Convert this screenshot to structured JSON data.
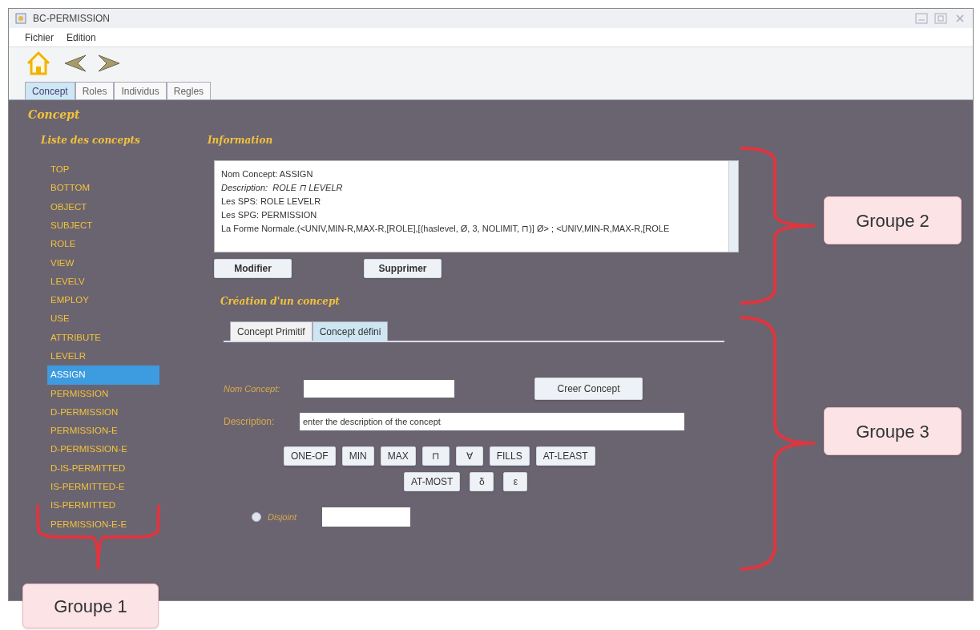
{
  "window": {
    "title": "BC-PERMISSION"
  },
  "menu": [
    "Fichier",
    "Edition"
  ],
  "tabs": [
    {
      "label": "Concept",
      "selected": true
    },
    {
      "label": "Roles",
      "selected": false
    },
    {
      "label": "Individus",
      "selected": false
    },
    {
      "label": "Regles",
      "selected": false
    }
  ],
  "panel_title": "Concept",
  "concept_list": {
    "title": "Liste des concepts",
    "items": [
      {
        "label": "TOP",
        "selected": false
      },
      {
        "label": "BOTTOM",
        "selected": false
      },
      {
        "label": "OBJECT",
        "selected": false
      },
      {
        "label": "SUBJECT",
        "selected": false
      },
      {
        "label": "ROLE",
        "selected": false
      },
      {
        "label": "VIEW",
        "selected": false
      },
      {
        "label": "LEVELV",
        "selected": false
      },
      {
        "label": "EMPLOY",
        "selected": false
      },
      {
        "label": "USE",
        "selected": false
      },
      {
        "label": "ATTRIBUTE",
        "selected": false
      },
      {
        "label": "LEVELR",
        "selected": false
      },
      {
        "label": "ASSIGN",
        "selected": true
      },
      {
        "label": "PERMISSION",
        "selected": false
      },
      {
        "label": "D-PERMISSION",
        "selected": false
      },
      {
        "label": "PERMISSION-E",
        "selected": false
      },
      {
        "label": "D-PERMISSION-E",
        "selected": false
      },
      {
        "label": "D-IS-PERMITTED",
        "selected": false
      },
      {
        "label": "IS-PERMITTED-E",
        "selected": false
      },
      {
        "label": "IS-PERMITTED",
        "selected": false
      },
      {
        "label": "PERMISSION-E-E",
        "selected": false
      }
    ]
  },
  "information": {
    "title": "Information",
    "lines": [
      {
        "text": "Nom Concept: ASSIGN",
        "italic": false
      },
      {
        "text": "Description:  ROLE ⊓ LEVELR",
        "italic": true
      },
      {
        "text": "Les SPS: ROLE LEVELR",
        "italic": false
      },
      {
        "text": "Les SPG: PERMISSION",
        "italic": false
      },
      {
        "text": "La Forme Normale.(<UNIV,MIN-R,MAX-R,[ROLE],[(haslevel, Ø, 3, NOLIMIT, ⊓)] Ø> ; <UNIV,MIN-R,MAX-R,[ROLE",
        "italic": false
      }
    ],
    "buttons": [
      "Modifier",
      "Supprimer"
    ]
  },
  "creation": {
    "title": "Création d'un concept",
    "tabs": [
      {
        "label": "Concept Primitif",
        "selected": false
      },
      {
        "label": "Concept défini",
        "selected": true
      }
    ],
    "name_label": "Nom Concept:",
    "create_button": "Creer Concept",
    "description_label": "Description:",
    "description_placeholder": "enter the description of the concept",
    "operators_row_1": [
      "ONE-OF",
      "MIN",
      "MAX",
      "⊓",
      "∀",
      "FILLS",
      "AT-LEAST"
    ],
    "operators_row_2": [
      "AT-MOST",
      "δ",
      "ε"
    ],
    "disjoint": {
      "label": "Disjoint",
      "checked": false
    }
  },
  "annotations": [
    {
      "label": "Groupe 1"
    },
    {
      "label": "Groupe 2"
    },
    {
      "label": "Groupe 3"
    }
  ]
}
